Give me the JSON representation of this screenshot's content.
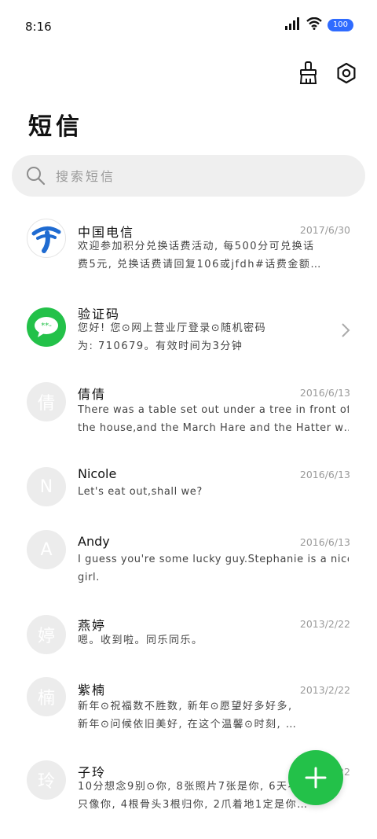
{
  "status": {
    "time": "8:16",
    "battery": "100"
  },
  "title": "短信",
  "search": {
    "placeholder": "搜索短信"
  },
  "conversations": [
    {
      "name": "中国电信",
      "date": "2017/6/30",
      "line1": "欢迎参加积分兑换话费活动, 每500分可兑换话",
      "line2": "费5元, 兑换话费请回复106或jfdh#话费金额…",
      "avatar": "china-telecom-logo"
    },
    {
      "name": "验证码",
      "date": "",
      "line1": "您好! 您⊙网上营业厅登录⊙随机密码",
      "line2": "为: 710679。有效时间为3分钟",
      "avatar": "message-bubble-icon"
    },
    {
      "name": "倩倩",
      "date": "2016/6/13",
      "line1": "There was a table set out under a tree in front of",
      "line2": "the house,and the March Hare and the Hatter w…",
      "avatar_letter": "倩"
    },
    {
      "name": "Nicole",
      "date": "2016/6/13",
      "line1": "Let's eat out,shall we?",
      "line2": "",
      "avatar_letter": "N"
    },
    {
      "name": "Andy",
      "date": "2016/6/13",
      "line1": "I guess you're some lucky guy.Stephanie is a nice",
      "line2": "girl.",
      "avatar_letter": "A"
    },
    {
      "name": "燕婷",
      "date": "2013/2/22",
      "line1": "嗯。收到啦。同乐同乐。",
      "line2": "",
      "avatar_letter": "婷"
    },
    {
      "name": "紫楠",
      "date": "2013/2/22",
      "line1": "新年⊙祝福数不胜数, 新年⊙愿望好多好多,",
      "line2": "新年⊙问候依旧美好, 在这个温馨⊙时刻, …",
      "avatar_letter": "楠"
    },
    {
      "name": "子玲",
      "date": "2013/2/22",
      "line1": "10分想念9别⊙你, 8张照片7张是你, 6天不见5",
      "line2": "只像你, 4根骨头3根归你, 2爪着地1定是你…",
      "avatar_letter": "玲"
    }
  ],
  "colors": {
    "accent": "#23c149",
    "telecom_blue": "#1f6bd1"
  }
}
